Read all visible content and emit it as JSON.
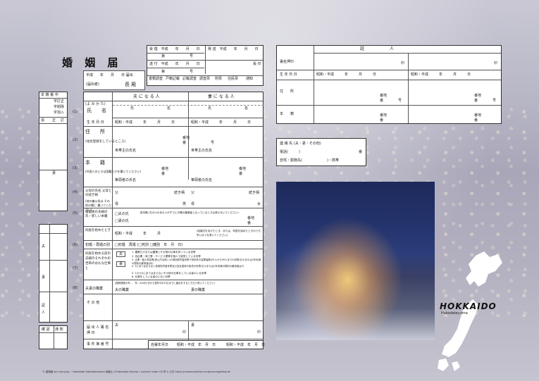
{
  "form": {
    "title": "婚 姻 届",
    "date_line": "平成　　年　　月　　日 届出",
    "recipient": "長 殿",
    "small_note": "(届出者)",
    "reception": {
      "received": "受 理　平成　　年　　月　　日",
      "num1": "第　　　　　　　号",
      "sent": "送 付　平成　　年　　月　　日",
      "num2": "第　　　　　　　号",
      "dispatch": "発 送　平成　　年　　月　　日",
      "head": "長 印",
      "checks": [
        "書類調査",
        "戸籍記載",
        "記載調査",
        "調査票",
        "附票",
        "住民票",
        "通知"
      ]
    },
    "husband": "夫 に な る 人",
    "wife": "妻 に な る 人",
    "furigana": "(よ み か た)",
    "name_label": "氏　　名",
    "family_name": "氏",
    "given_name": "名",
    "birth_label": "生 年 月 日",
    "birth_value": "昭和・平成　　　年　　　月　　　日",
    "address_label": "住　　所",
    "address_note": "(住民登録をしているところ)",
    "banchi": "番地",
    "ban": "番",
    "go": "号",
    "householder": "世帯主の氏名",
    "honseki_label": "本　　籍",
    "honseki_note": "(外国人のときは国籍だけを書いてください)",
    "hittousha": "筆頭者の氏名",
    "parents_label": "父母の氏名 父母との続き柄",
    "parents_note": "(他の養父母は その他の欄に 書いてください)",
    "father": "父",
    "mother": "母",
    "relation": "続き柄",
    "son": "男",
    "daughter": "女",
    "after_marriage": "婚姻後の夫婦の氏・新しい本籍",
    "after_option1": "□夫の氏",
    "after_option2": "□妻の氏",
    "new_honseki": "新本籍 (左の☑の氏の人がすでに戸籍の筆頭者となっているときは書かないでください)",
    "cohabit_label": "同居を始めたとき",
    "cohabit_value": "昭和・平成　　　年　　　月",
    "cohabit_note": "(結婚式をあげたとき、または、同居を始めたときのうち早いほうを書いてください)",
    "first_marriage": "初婚・再婚の別",
    "first_marriage_opts": "□初婚　再婚 (□死別 □離別　年　月　日)",
    "household_label": "同居を始める前の夫婦のそれぞれの世帯のおもな仕事と",
    "household_items": [
      "1. 農業だけまたは農業とその他の仕事を持っている世帯",
      "2. 自由業・商工業・サービス業等を個人で経営している世帯",
      "3. 企業・個人商店等(官公庁は除く)の常用勤労者世帯で勤め先の従業者数が1人から99人までの世帯(日々または1年未満の契約の雇用者は5)",
      "4. 3にあてはまらない常用勤労者世帯及び会社団体の役員の世帯(日々または1年未満の契約の雇用者は5)",
      "5. 1から4にあてはまらないその他の仕事をしている者のいる世帯",
      "6. 仕事をしている者のいない世帯"
    ],
    "husband_short": "夫",
    "wife_short": "妻",
    "occupation_label": "夫妻の職業",
    "occupation_note": "(国勢調査の年…　年…の4月1日から翌年3月31日までに届出をするときだけ書いてください)",
    "husband_job": "夫の職業",
    "wife_job": "妻の職業",
    "other_label": "そ の 他",
    "signer_label": "届 出 人 署 名 押 印",
    "seal": "印",
    "case_number": "事 件 簿 番 号",
    "self_date": "自署年月日",
    "self_date_value": "昭和・平成　年　月　日",
    "side_numbers": [
      "(1)",
      "(2)",
      "(3)",
      "(4)",
      "(5)",
      "(6)",
      "(7)",
      "(8)"
    ]
  },
  "side": {
    "header": "本 籍 番 中",
    "col1": [
      "字訂正",
      "字削除",
      "字加入"
    ],
    "items": [
      "追",
      "正",
      "訂"
    ],
    "bottom": "妻",
    "lower_labels": [
      "夫",
      "妻",
      "証",
      "人"
    ],
    "notify": [
      "確 認",
      "通 知"
    ]
  },
  "witness": {
    "title": "証　　　　　　人",
    "sign_label": "署名押印",
    "birth_label": "生 年 月 日",
    "birth_value": "昭和・平成　　　年　　　月　　　日",
    "address_label": "住　　所",
    "honseki_label": "本　　籍",
    "banchi": "番地",
    "ban": "番",
    "go": "号",
    "seal": "印"
  },
  "contact": {
    "title": "連 絡 先 (夫・妻・その他)",
    "phone": "電話(　　　)",
    "phone_end": "番",
    "type": "自宅・勤務先(　　　　　　　)・携帯"
  },
  "brand": {
    "name": "HOKKAIDO",
    "place": "Hakodateyama",
    "footer": "© 婚姻届 by marrying ・Hakodate Hakodateyama 函館山 ©Hakodate Yacone / contact under CK 許 a 公式 https://naxnaxmotheru.org/marriageflow.dk"
  }
}
